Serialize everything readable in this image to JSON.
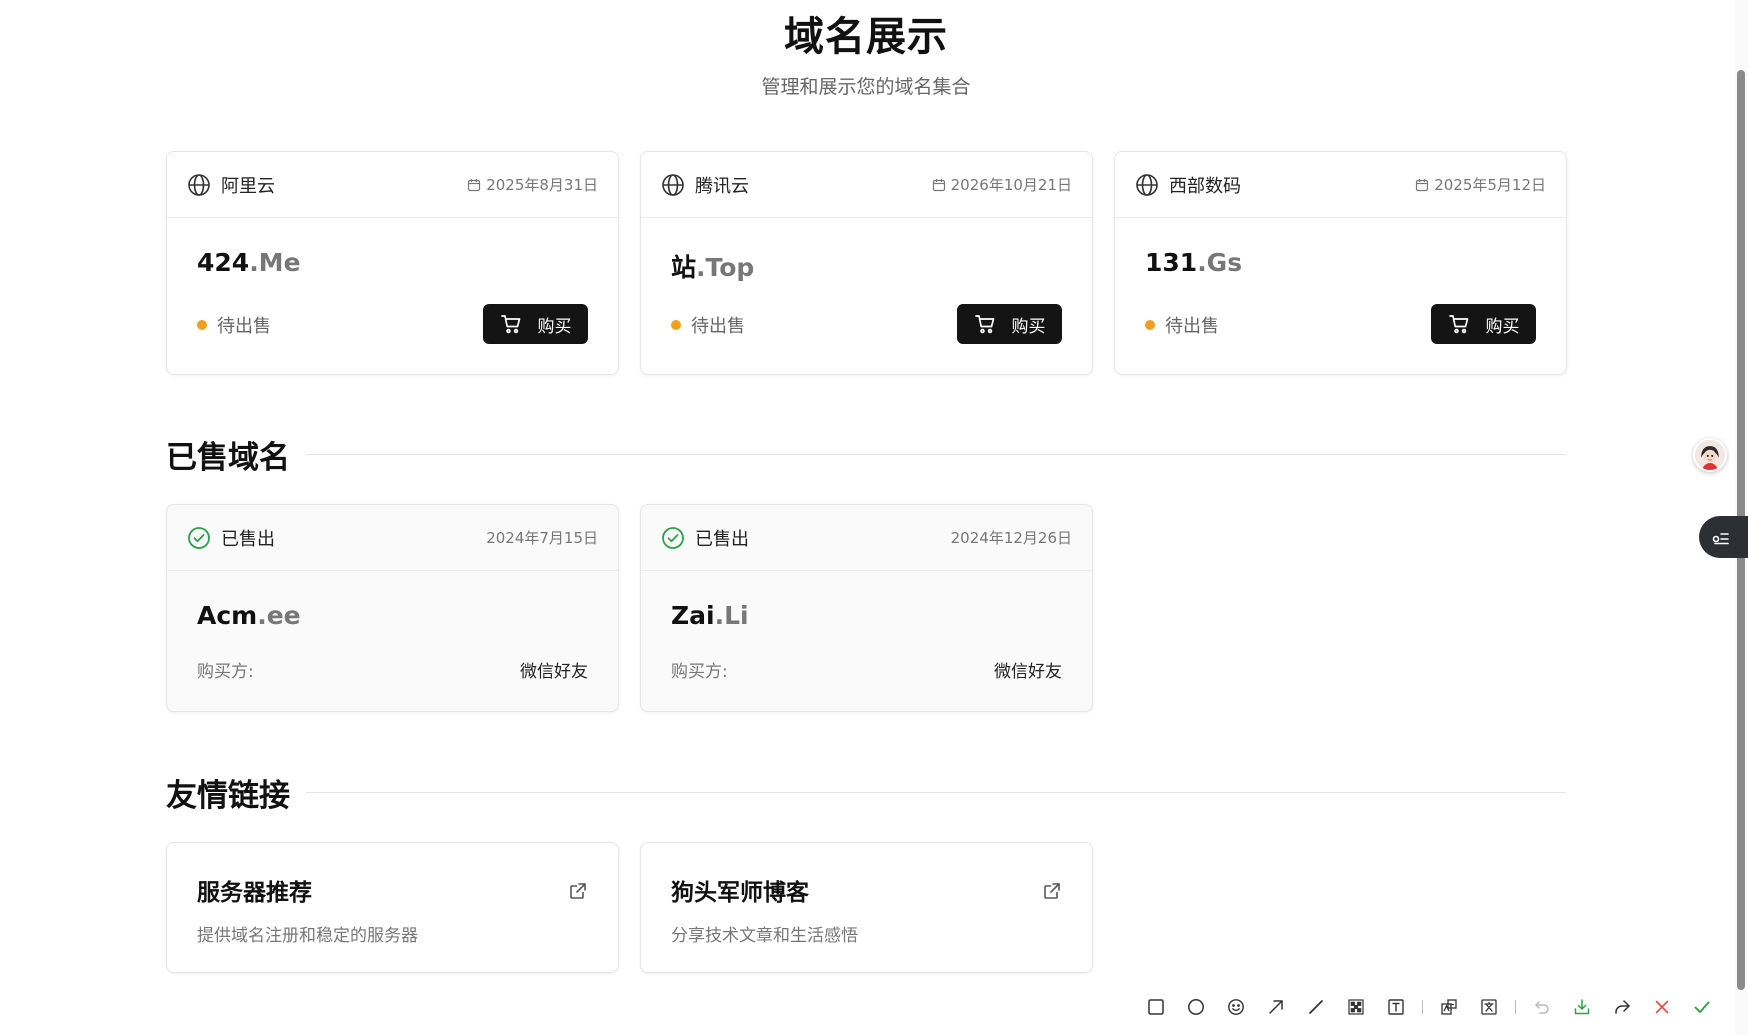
{
  "hero": {
    "title": "域名展示",
    "subtitle": "管理和展示您的域名集合"
  },
  "for_sale": [
    {
      "registrar": "阿里云",
      "date": "2025年8月31日",
      "domain_name": "424",
      "tld": ".Me",
      "status": "待出售",
      "buy_label": "购买"
    },
    {
      "registrar": "腾讯云",
      "date": "2026年10月21日",
      "domain_name": "站",
      "tld": ".Top",
      "status": "待出售",
      "buy_label": "购买"
    },
    {
      "registrar": "西部数码",
      "date": "2025年5月12日",
      "domain_name": "131",
      "tld": ".Gs",
      "status": "待出售",
      "buy_label": "购买"
    }
  ],
  "sold_section": {
    "title": "已售域名",
    "items": [
      {
        "status": "已售出",
        "date": "2024年7月15日",
        "domain_name": "Acm",
        "tld": ".ee",
        "buyer_label": "购买方:",
        "buyer": "微信好友"
      },
      {
        "status": "已售出",
        "date": "2024年12月26日",
        "domain_name": "Zai",
        "tld": ".Li",
        "buyer_label": "购买方:",
        "buyer": "微信好友"
      }
    ]
  },
  "links_section": {
    "title": "友情链接",
    "items": [
      {
        "name": "服务器推荐",
        "desc": "提供域名注册和稳定的服务器"
      },
      {
        "name": "狗头军师博客",
        "desc": "分享技术文章和生活感悟"
      }
    ]
  },
  "colors": {
    "status_pending": "#f0a020",
    "status_sold": "#2aa24a",
    "button_bg": "#141414",
    "toolbar_save": "#2aa24a",
    "toolbar_cancel": "#e05050",
    "toolbar_confirm": "#2aa24a"
  },
  "toolbar": {
    "tools": [
      "rectangle-icon",
      "ellipse-icon",
      "emoji-icon",
      "arrow-icon",
      "line-icon",
      "mosaic-icon",
      "text-icon",
      "ocr-icon",
      "translate-icon",
      "undo-icon",
      "save-icon",
      "share-icon",
      "close-icon",
      "confirm-icon"
    ]
  }
}
